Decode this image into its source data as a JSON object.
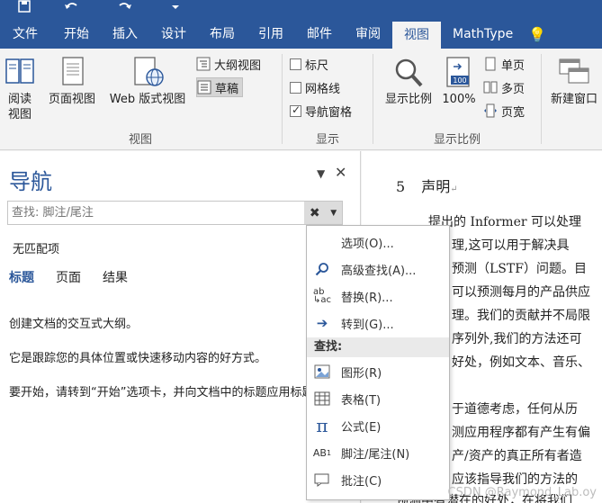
{
  "ribbon_tabs": [
    "文件",
    "开始",
    "插入",
    "设计",
    "布局",
    "引用",
    "邮件",
    "审阅",
    "视图",
    "MathType"
  ],
  "active_tab": "视图",
  "views_group": {
    "label": "视图",
    "read_mode": "阅读\n视图",
    "print_layout": "页面视图",
    "web_layout": "Web 版式视图",
    "outline": "大纲视图",
    "draft": "草稿"
  },
  "show_group": {
    "label": "显示",
    "ruler": "标尺",
    "gridlines": "网格线",
    "nav_pane": "导航窗格"
  },
  "zoom_group": {
    "label": "显示比例",
    "zoom": "显示比例",
    "hundred": "100%",
    "hundred_icon_text": "100",
    "one_page": "单页",
    "multi_page": "多页",
    "page_width": "页宽"
  },
  "window_group": {
    "new_window": "新建窗口"
  },
  "nav": {
    "title": "导航",
    "search_placeholder": "查找: 脚注/尾注",
    "no_match": "无匹配项",
    "tabs": [
      "标题",
      "页面",
      "结果"
    ],
    "text1": "创建文档的交互式大纲。",
    "text2": "它是跟踪您的具体位置或快速移动内容的好方式。",
    "text3": "要开始，请转到“开始”选项卡，并向文档中的标题应用标题样式。"
  },
  "menu": {
    "options": "选项(O)...",
    "advanced_find": "高级查找(A)...",
    "replace": "替换(R)...",
    "goto": "转到(G)...",
    "find_header": "查找:",
    "graphics": "图形(R)",
    "tables": "表格(T)",
    "equations": "公式(E)",
    "footnotes": "脚注/尾注(N)",
    "comments": "批注(C)"
  },
  "doc": {
    "heading_num": "5",
    "heading_text": "声明",
    "lines": [
      "提出的 Informer 可以处理",
      "理,这可以用于解决具",
      "预测（LSTF）问题。目",
      "可以预测每月的产品供应",
      "理。我们的贡献并不局限",
      "序列外,我们的方法还可",
      "好处，例如文本、音乐、",
      "于道德考虑，任何从历",
      "测应用程序都有产生有偏",
      "产/资产的真正所有者造",
      "应该指导我们的方法的",
      "预测中有潜在的好处，在将我们"
    ]
  },
  "watermark": "CSDN @Raymond_Lab.oy"
}
